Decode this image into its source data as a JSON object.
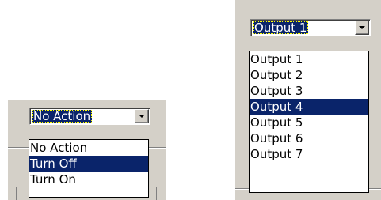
{
  "colors": {
    "panel": "#d4d0c8",
    "highlight": "#0a246a",
    "highlight_text": "#ffffff"
  },
  "left_combo": {
    "selected": "No Action",
    "dropdown_icon": "chevron-down-icon",
    "options": [
      {
        "label": "No Action",
        "highlighted": false
      },
      {
        "label": "Turn Off",
        "highlighted": true
      },
      {
        "label": "Turn On",
        "highlighted": false
      }
    ]
  },
  "right_combo": {
    "selected": "Output 1",
    "dropdown_icon": "chevron-down-icon",
    "options": [
      {
        "label": "Output 1",
        "highlighted": false
      },
      {
        "label": "Output 2",
        "highlighted": false
      },
      {
        "label": "Output 3",
        "highlighted": false
      },
      {
        "label": "Output 4",
        "highlighted": true
      },
      {
        "label": "Output 5",
        "highlighted": false
      },
      {
        "label": "Output 6",
        "highlighted": false
      },
      {
        "label": "Output 7",
        "highlighted": false
      }
    ]
  }
}
